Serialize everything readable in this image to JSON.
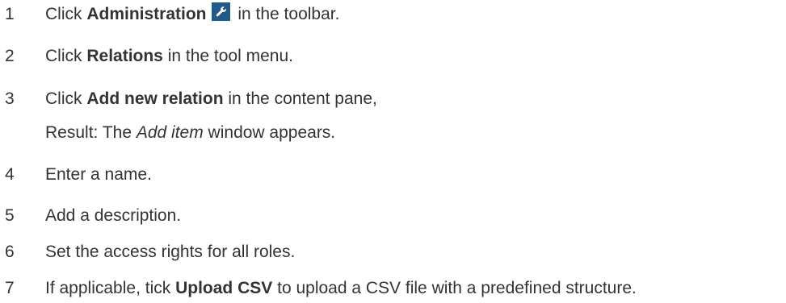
{
  "steps": [
    {
      "number": "1",
      "pre": "Click ",
      "bold": "Administration",
      "icon": "wrench-icon",
      "post": " in the toolbar."
    },
    {
      "number": "2",
      "pre": "Click ",
      "bold": "Relations",
      "post": " in the tool menu."
    },
    {
      "number": "3",
      "pre": "Click ",
      "bold": "Add new relation",
      "post": " in the content pane,"
    },
    {
      "result_pre": "Result: The ",
      "result_italic": "Add item",
      "result_post": " window appears."
    },
    {
      "number": "4",
      "text": "Enter a name."
    },
    {
      "number": "5",
      "text": "Add a description."
    },
    {
      "number": "6",
      "text": "Set the access rights for all roles."
    },
    {
      "number": "7",
      "pre": "If applicable, tick ",
      "bold": "Upload CSV",
      "post": " to upload a CSV file with a predefined structure."
    }
  ],
  "colors": {
    "text": "#333333",
    "icon_background": "#1e5a8c",
    "icon_glyph": "#ffffff"
  }
}
